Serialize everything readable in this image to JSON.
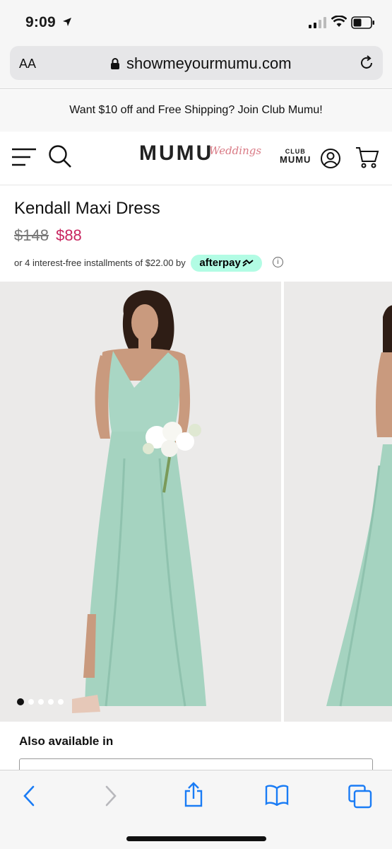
{
  "status": {
    "time": "9:09"
  },
  "browser": {
    "aa_label": "AA",
    "url": "showmeyourmumu.com"
  },
  "promo": {
    "text": "Want $10 off and Free Shipping? Join Club Mumu!"
  },
  "header": {
    "logo": "MUMU",
    "logo_script": "Weddings",
    "club_top": "CLUB",
    "club_bottom": "MUMU"
  },
  "product": {
    "title": "Kendall Maxi Dress",
    "price_old": "$148",
    "price_new": "$88",
    "afterpay_text": "or 4 interest-free installments of $22.00 by",
    "afterpay_brand": "afterpay",
    "info_symbol": "i",
    "gallery_position": 1,
    "gallery_count": 5
  },
  "also": {
    "heading": "Also available in"
  },
  "colors": {
    "accent_price": "#c8255f",
    "afterpay_mint": "#b2fce4",
    "ios_blue": "#1a7cf5",
    "dress_sage": "#a9d6c4"
  }
}
